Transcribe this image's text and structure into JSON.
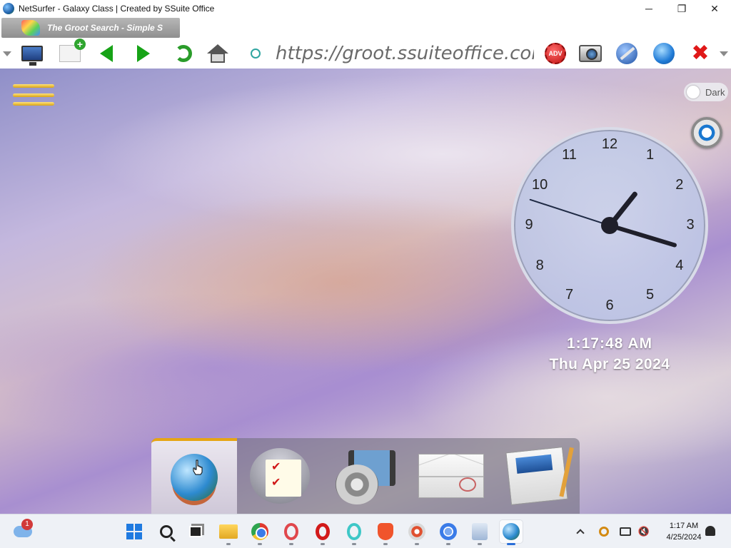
{
  "window": {
    "title": "NetSurfer - Galaxy Class | Created by SSuite Office",
    "controls": {
      "minimize": "─",
      "maximize": "❐",
      "close": "✕"
    }
  },
  "tab": {
    "label": "The Groot Search - Simple S"
  },
  "toolbar": {
    "url": "https://groot.ssuiteoffice.com",
    "adv_label": "ADV",
    "icons": [
      "dropdown-icon",
      "monitor-icon",
      "new-tab-icon",
      "back-icon",
      "forward-icon",
      "reload-icon",
      "home-icon",
      "status-icon",
      "adv-icon",
      "screenshot-icon",
      "tools-icon",
      "globe-icon",
      "close-red-icon",
      "dropdown-icon"
    ]
  },
  "page": {
    "dark_toggle_label": "Dark",
    "clock": {
      "numerals": [
        "12",
        "1",
        "2",
        "3",
        "4",
        "5",
        "6",
        "7",
        "8",
        "9",
        "10",
        "11"
      ],
      "time": "1:17:48 AM",
      "date": "Thu Apr 25 2024",
      "hour": 1,
      "minute": 17,
      "second": 48
    },
    "dock": [
      "browser-globe",
      "notes",
      "media-player",
      "mail",
      "writer"
    ]
  },
  "taskbar": {
    "weather_badge": "1",
    "clock_time": "1:17 AM",
    "clock_date": "4/25/2024",
    "accent": "#2a6ed8"
  }
}
